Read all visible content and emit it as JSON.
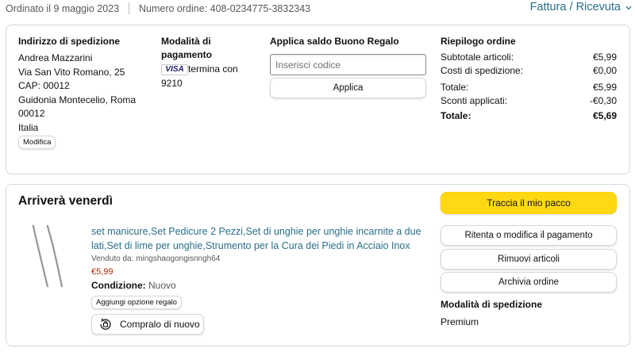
{
  "header": {
    "order_date": "Ordinato il 9 maggio 2023",
    "order_number": "Numero ordine: 408-0234775-3832343",
    "invoice_link": "Fattura / Ricevuta"
  },
  "shipping_address": {
    "title": "Indirizzo di spedizione",
    "lines": [
      "Andrea Mazzarini",
      "Via San Vito Romano, 25",
      "CAP: 00012",
      "Guidonia Montecelio, Roma",
      "00012",
      "Italia"
    ],
    "edit_button": "Modifica"
  },
  "payment": {
    "title_line1": "Modalità di",
    "title_line2": "pagamento",
    "card_brand": "VISA",
    "card_text": "termina con",
    "card_last4": "9210"
  },
  "gift_card": {
    "title": "Applica saldo Buono Regalo",
    "input_placeholder": "Inserisci codice",
    "apply_button": "Applica"
  },
  "summary": {
    "title": "Riepilogo ordine",
    "rows": [
      {
        "label": "Subtotale articoli:",
        "value": "€5,99"
      },
      {
        "label": "Costi di spedizione:",
        "value": "€0,00"
      },
      {
        "label": "Totale:",
        "value": "€5,99"
      },
      {
        "label": "Sconti applicati:",
        "value": "-€0,30"
      },
      {
        "label": "Totale:",
        "value": "€5,69"
      }
    ]
  },
  "shipment": {
    "arrival": "Arriverà venerdì",
    "product_title": "set manicure,Set Pedicure 2 Pezzi,Set di unghie per unghie incarnite a due lati,Set di lime per unghie,Strumento per la Cura dei Piedi in Acciaio Inox",
    "seller": "Venduto da: mingshaogongisnngh64",
    "price": "€5,99",
    "condition_label": "Condizione:",
    "condition_value": "Nuovo",
    "gift_button": "Aggiungi opzione regalo",
    "buy_again_button": "Compralo di nuovo",
    "actions": {
      "track": "Traccia il mio pacco",
      "retry_payment": "Ritenta o modifica il pagamento",
      "remove_items": "Rimuovi articoli",
      "archive": "Archivia ordine"
    },
    "shipping_method_title": "Modalità di spedizione",
    "shipping_method_value": "Premium"
  },
  "colors": {
    "link": "#2a6f87",
    "price": "#b12704",
    "primary_button": "#ffd814"
  }
}
